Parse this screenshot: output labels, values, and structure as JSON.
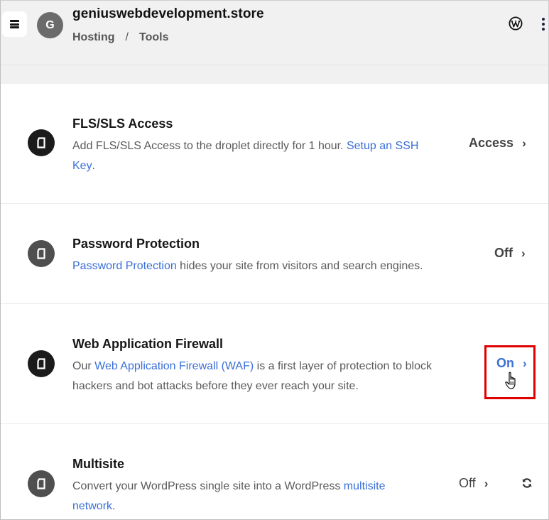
{
  "header": {
    "menu_icon": "hamburger-menu-icon",
    "avatar_letter": "G",
    "site_title": "geniuswebdevelopment.store",
    "breadcrumb": [
      {
        "label": "Hosting"
      },
      {
        "label": "Tools"
      }
    ],
    "breadcrumb_separator": "/",
    "wordpress_icon": "wordpress-icon",
    "more_icon": "kebab-menu-icon"
  },
  "tools": [
    {
      "title": "FLS/SLS Access",
      "desc_prefix": "Add FLS/SLS Access to the droplet directly for 1 hour. ",
      "link_text": "Setup an SSH Key",
      "desc_suffix": ".",
      "action_label": "Access",
      "action_state": "neutral",
      "icon": "document-icon"
    },
    {
      "title": "Password Protection",
      "desc_prefix": "",
      "link_text": "Password Protection",
      "desc_suffix": " hides your site from visitors and search engines.",
      "action_label": "Off",
      "action_state": "off",
      "icon": "document-icon"
    },
    {
      "title": "Web Application Firewall",
      "desc_prefix": "Our ",
      "link_text": "Web Application Firewall (WAF)",
      "desc_suffix": " is a first layer of protection to block hackers and bot attacks before they ever reach your site.",
      "action_label": "On",
      "action_state": "on",
      "icon": "document-icon"
    },
    {
      "title": "Multisite",
      "desc_prefix": "Convert your WordPress single site into a WordPress ",
      "link_text": "multisite network",
      "desc_suffix": ".",
      "action_label": "Off",
      "action_state": "off",
      "icon": "document-icon",
      "extra_icon": "refresh-icon"
    }
  ],
  "chevron": "›",
  "colors": {
    "link": "#3a6fd8",
    "highlight_border": "#e00000",
    "header_bg": "#f1f1f1"
  }
}
